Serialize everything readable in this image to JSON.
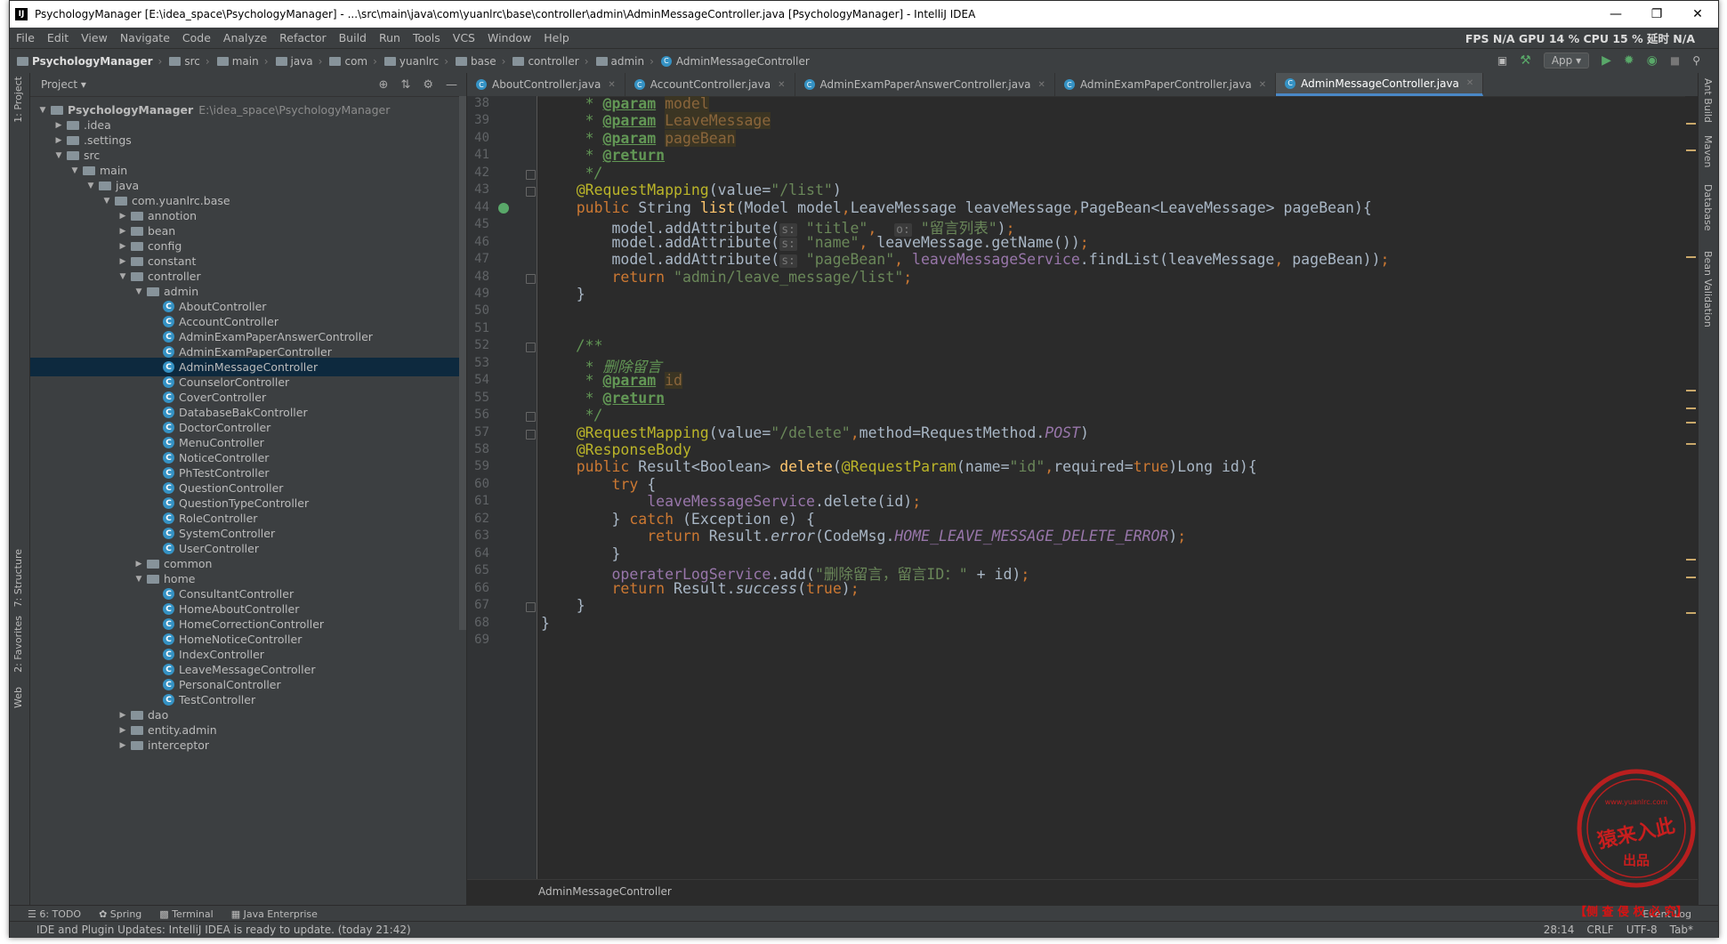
{
  "window": {
    "title": "PsychologyManager [E:\\idea_space\\PsychologyManager] - ...\\src\\main\\java\\com\\yuanlrc\\base\\controller\\admin\\AdminMessageController.java [PsychologyManager] - IntelliJ IDEA"
  },
  "menu": [
    "File",
    "Edit",
    "View",
    "Navigate",
    "Code",
    "Analyze",
    "Refactor",
    "Build",
    "Run",
    "Tools",
    "VCS",
    "Window",
    "Help"
  ],
  "perf": "FPS  N/A  GPU  14 %  CPU  15 %  延时  N/A",
  "breadcrumb": [
    "PsychologyManager",
    "src",
    "main",
    "java",
    "com",
    "yuanlrc",
    "base",
    "controller",
    "admin",
    "AdminMessageController"
  ],
  "run_config": "App",
  "left_strip": [
    "1: Project",
    "7: Structure",
    "2: Favorites",
    "Web"
  ],
  "right_strip": [
    "Ant Build",
    "Maven",
    "Database",
    "Bean Validation"
  ],
  "project_panel": {
    "title": "Project",
    "tree": [
      {
        "label": "PsychologyManager",
        "hint": "E:\\idea_space\\PsychologyManager",
        "depth": 0,
        "type": "folder",
        "open": true,
        "bold": true
      },
      {
        "label": ".idea",
        "depth": 1,
        "type": "folder",
        "open": false
      },
      {
        "label": ".settings",
        "depth": 1,
        "type": "folder",
        "open": false
      },
      {
        "label": "src",
        "depth": 1,
        "type": "folder",
        "open": true
      },
      {
        "label": "main",
        "depth": 2,
        "type": "folder",
        "open": true
      },
      {
        "label": "java",
        "depth": 3,
        "type": "folder",
        "open": true
      },
      {
        "label": "com.yuanlrc.base",
        "depth": 4,
        "type": "folder",
        "open": true
      },
      {
        "label": "annotion",
        "depth": 5,
        "type": "folder",
        "open": false
      },
      {
        "label": "bean",
        "depth": 5,
        "type": "folder",
        "open": false
      },
      {
        "label": "config",
        "depth": 5,
        "type": "folder",
        "open": false
      },
      {
        "label": "constant",
        "depth": 5,
        "type": "folder",
        "open": false
      },
      {
        "label": "controller",
        "depth": 5,
        "type": "folder",
        "open": true
      },
      {
        "label": "admin",
        "depth": 6,
        "type": "folder",
        "open": true
      },
      {
        "label": "AboutController",
        "depth": 7,
        "type": "class"
      },
      {
        "label": "AccountController",
        "depth": 7,
        "type": "class"
      },
      {
        "label": "AdminExamPaperAnswerController",
        "depth": 7,
        "type": "class"
      },
      {
        "label": "AdminExamPaperController",
        "depth": 7,
        "type": "class"
      },
      {
        "label": "AdminMessageController",
        "depth": 7,
        "type": "class",
        "selected": true
      },
      {
        "label": "CounselorController",
        "depth": 7,
        "type": "class"
      },
      {
        "label": "CoverController",
        "depth": 7,
        "type": "class"
      },
      {
        "label": "DatabaseBakController",
        "depth": 7,
        "type": "class"
      },
      {
        "label": "DoctorController",
        "depth": 7,
        "type": "class"
      },
      {
        "label": "MenuController",
        "depth": 7,
        "type": "class"
      },
      {
        "label": "NoticeController",
        "depth": 7,
        "type": "class"
      },
      {
        "label": "PhTestController",
        "depth": 7,
        "type": "class"
      },
      {
        "label": "QuestionController",
        "depth": 7,
        "type": "class"
      },
      {
        "label": "QuestionTypeController",
        "depth": 7,
        "type": "class"
      },
      {
        "label": "RoleController",
        "depth": 7,
        "type": "class"
      },
      {
        "label": "SystemController",
        "depth": 7,
        "type": "class"
      },
      {
        "label": "UserController",
        "depth": 7,
        "type": "class"
      },
      {
        "label": "common",
        "depth": 6,
        "type": "folder",
        "open": false
      },
      {
        "label": "home",
        "depth": 6,
        "type": "folder",
        "open": true
      },
      {
        "label": "ConsultantController",
        "depth": 7,
        "type": "class"
      },
      {
        "label": "HomeAboutController",
        "depth": 7,
        "type": "class"
      },
      {
        "label": "HomeCorrectionController",
        "depth": 7,
        "type": "class"
      },
      {
        "label": "HomeNoticeController",
        "depth": 7,
        "type": "class"
      },
      {
        "label": "IndexController",
        "depth": 7,
        "type": "class"
      },
      {
        "label": "LeaveMessageController",
        "depth": 7,
        "type": "class"
      },
      {
        "label": "PersonalController",
        "depth": 7,
        "type": "class"
      },
      {
        "label": "TestController",
        "depth": 7,
        "type": "class"
      },
      {
        "label": "dao",
        "depth": 5,
        "type": "folder",
        "open": false
      },
      {
        "label": "entity.admin",
        "depth": 5,
        "type": "folder",
        "open": false
      },
      {
        "label": "interceptor",
        "depth": 5,
        "type": "folder",
        "open": false
      }
    ]
  },
  "tabs": [
    {
      "label": "AboutController.java",
      "active": false
    },
    {
      "label": "AccountController.java",
      "active": false
    },
    {
      "label": "AdminExamPaperAnswerController.java",
      "active": false
    },
    {
      "label": "AdminExamPaperController.java",
      "active": false
    },
    {
      "label": "AdminMessageController.java",
      "active": true
    }
  ],
  "editor": {
    "first_line": 38,
    "lines": [
      [
        [
          "cmt",
          "     * "
        ],
        [
          "tag",
          "@param"
        ],
        [
          "cmt",
          " "
        ],
        [
          "par",
          "model"
        ]
      ],
      [
        [
          "cmt",
          "     * "
        ],
        [
          "tag",
          "@param"
        ],
        [
          "cmt",
          " "
        ],
        [
          "par",
          "LeaveMessage"
        ]
      ],
      [
        [
          "cmt",
          "     * "
        ],
        [
          "tag",
          "@param"
        ],
        [
          "cmt",
          " "
        ],
        [
          "par",
          "pageBean"
        ]
      ],
      [
        [
          "cmt",
          "     * "
        ],
        [
          "tag",
          "@return"
        ]
      ],
      [
        [
          "cmt",
          "     */"
        ]
      ],
      [
        [
          "ann",
          "    @RequestMapping"
        ],
        [
          "",
          "(value="
        ],
        [
          "str",
          "\"/list\""
        ],
        [
          "",
          ")"
        ]
      ],
      [
        [
          "kw",
          "    public "
        ],
        [
          "",
          "String "
        ],
        [
          "fn",
          "list"
        ],
        [
          "",
          "(Model model"
        ],
        [
          "kw",
          ","
        ],
        [
          "",
          "LeaveMessage leaveMessage"
        ],
        [
          "kw",
          ","
        ],
        [
          "",
          "PageBean<LeaveMessage> pageBean){"
        ]
      ],
      [
        [
          "",
          "        model.addAttribute("
        ],
        [
          "hint2",
          "s:"
        ],
        [
          "str",
          " \"title\""
        ],
        [
          "kw",
          ",  "
        ],
        [
          "hint2",
          "o:"
        ],
        [
          "str",
          " \"留言列表\""
        ],
        [
          "",
          ")"
        ],
        [
          "kw",
          ";"
        ]
      ],
      [
        [
          "",
          "        model.addAttribute("
        ],
        [
          "hint2",
          "s:"
        ],
        [
          "str",
          " \"name\""
        ],
        [
          "kw",
          ", "
        ],
        [
          "",
          "leaveMessage.getName())"
        ],
        [
          "kw",
          ";"
        ]
      ],
      [
        [
          "",
          "        model.addAttribute("
        ],
        [
          "hint2",
          "s:"
        ],
        [
          "str",
          " \"pageBean\""
        ],
        [
          "kw",
          ", "
        ],
        [
          "field",
          "leaveMessageService"
        ],
        [
          "",
          ".findList(leaveMessage"
        ],
        [
          "kw",
          ", "
        ],
        [
          "",
          "pageBean))"
        ],
        [
          "kw",
          ";"
        ]
      ],
      [
        [
          "kw",
          "        return "
        ],
        [
          "str",
          "\"admin/leave_message/list\""
        ],
        [
          "kw",
          ";"
        ]
      ],
      [
        [
          "",
          "    }"
        ]
      ],
      [
        [
          "",
          ""
        ]
      ],
      [
        [
          "",
          ""
        ]
      ],
      [
        [
          "cmt",
          "    /**"
        ]
      ],
      [
        [
          "cmt",
          "     * 删除留言"
        ]
      ],
      [
        [
          "cmt",
          "     * "
        ],
        [
          "tag",
          "@param"
        ],
        [
          "cmt",
          " "
        ],
        [
          "par",
          "id"
        ]
      ],
      [
        [
          "cmt",
          "     * "
        ],
        [
          "tag",
          "@return"
        ]
      ],
      [
        [
          "cmt",
          "     */"
        ]
      ],
      [
        [
          "ann",
          "    @RequestMapping"
        ],
        [
          "",
          "(value="
        ],
        [
          "str",
          "\"/delete\""
        ],
        [
          "kw",
          ","
        ],
        [
          "",
          "method=RequestMethod."
        ],
        [
          "fitalic",
          "POST"
        ],
        [
          "",
          ")"
        ]
      ],
      [
        [
          "ann",
          "    @ResponseBody"
        ]
      ],
      [
        [
          "kw",
          "    public "
        ],
        [
          "",
          "Result<Boolean> "
        ],
        [
          "fn",
          "delete"
        ],
        [
          "",
          "("
        ],
        [
          "ann",
          "@RequestParam"
        ],
        [
          "",
          "(name="
        ],
        [
          "str",
          "\"id\""
        ],
        [
          "kw",
          ","
        ],
        [
          "",
          "required="
        ],
        [
          "kw",
          "true"
        ],
        [
          "",
          ")Long id){"
        ]
      ],
      [
        [
          "kw",
          "        try "
        ],
        [
          "",
          "{"
        ]
      ],
      [
        [
          "field",
          "            leaveMessageService"
        ],
        [
          "",
          ".delete(id)"
        ],
        [
          "kw",
          ";"
        ]
      ],
      [
        [
          "",
          "        } "
        ],
        [
          "kw",
          "catch "
        ],
        [
          "",
          "(Exception e) {"
        ]
      ],
      [
        [
          "kw",
          "            return "
        ],
        [
          "",
          "Result."
        ],
        [
          "ital",
          "error"
        ],
        [
          "",
          "(CodeMsg."
        ],
        [
          "fitalic",
          "HOME_LEAVE_MESSAGE_DELETE_ERROR"
        ],
        [
          "",
          ")"
        ],
        [
          "kw",
          ";"
        ]
      ],
      [
        [
          "",
          "        }"
        ]
      ],
      [
        [
          "field",
          "        operaterLogService"
        ],
        [
          "",
          ".add("
        ],
        [
          "str",
          "\"删除留言，留言ID：\""
        ],
        [
          "",
          " + id)"
        ],
        [
          "kw",
          ";"
        ]
      ],
      [
        [
          "kw",
          "        return "
        ],
        [
          "",
          "Result."
        ],
        [
          "ital",
          "success"
        ],
        [
          "",
          "("
        ],
        [
          "kw",
          "true"
        ],
        [
          "",
          ")"
        ],
        [
          "kw",
          ";"
        ]
      ],
      [
        [
          "",
          "    }"
        ]
      ],
      [
        [
          "",
          "}"
        ]
      ],
      [
        [
          "",
          ""
        ]
      ]
    ],
    "breadcrumb": "AdminMessageController"
  },
  "bottom_tools": [
    "6: TODO",
    "Spring",
    "Terminal",
    "Java Enterprise"
  ],
  "event_log": "Event Log",
  "status": {
    "message": "IDE and Plugin Updates: IntelliJ IDEA is ready to update. (today 21:42)",
    "position": "28:14",
    "line_sep": "CRLF",
    "encoding": "UTF-8",
    "indent": "Tab*"
  },
  "watermark": {
    "stamp_text": "猿来入此",
    "stamp_sub": "出品",
    "stamp_url": "www.yuanlrc.com",
    "footer": "【侧 查 侵 权 必 究】"
  },
  "colors": {
    "editor_bg": "#2b2b2b",
    "keyword": "#cc7832",
    "string": "#6a8759",
    "annotation": "#bbb529",
    "field": "#9876aa",
    "selection": "#0d293e",
    "accent": "#4a88c7"
  }
}
